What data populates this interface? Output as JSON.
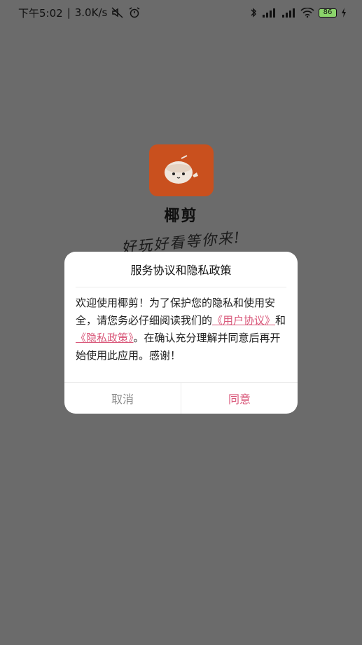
{
  "status_bar": {
    "time": "下午5:02",
    "speed": "3.0K/s",
    "battery_level": "86",
    "icons": [
      "muted-icon",
      "alarm-icon",
      "bluetooth-icon",
      "signal-icon",
      "wifi-icon",
      "charging-icon"
    ]
  },
  "splash": {
    "app_name": "椰剪",
    "slogan": "好玩好看等你来!"
  },
  "dialog": {
    "title": "服务协议和隐私政策",
    "body_prefix": "欢迎使用椰剪！为了保护您的隐私和使用安全，请您务必仔细阅读我们的",
    "user_agreement_link": "《用户协议》",
    "and_text": "和",
    "privacy_policy_link": "《隐私政策》",
    "body_suffix": "。在确认充分理解并同意后再开始使用此应用。感谢！",
    "cancel_label": "取消",
    "agree_label": "同意"
  },
  "colors": {
    "overlay": "#6b6b6b",
    "accent": "#d9587a",
    "logo_bg": "#c9501e"
  }
}
